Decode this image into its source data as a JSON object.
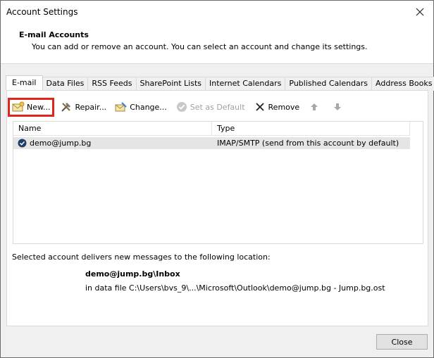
{
  "window": {
    "title": "Account Settings"
  },
  "header": {
    "title": "E-mail Accounts",
    "description": "You can add or remove an account. You can select an account and change its settings."
  },
  "tabs": [
    {
      "label": "E-mail",
      "active": true
    },
    {
      "label": "Data Files"
    },
    {
      "label": "RSS Feeds"
    },
    {
      "label": "SharePoint Lists"
    },
    {
      "label": "Internet Calendars"
    },
    {
      "label": "Published Calendars"
    },
    {
      "label": "Address Books"
    }
  ],
  "toolbar": {
    "new_label": "New...",
    "repair_label": "Repair...",
    "change_label": "Change...",
    "set_default_label": "Set as Default",
    "remove_label": "Remove"
  },
  "accounts": {
    "columns": {
      "name": "Name",
      "type": "Type"
    },
    "rows": [
      {
        "name": "demo@jump.bg",
        "type": "IMAP/SMTP (send from this account by default)"
      }
    ]
  },
  "delivery": {
    "label": "Selected account delivers new messages to the following location:",
    "folder": "demo@jump.bg\\Inbox",
    "file": "in data file C:\\Users\\bvs_9\\...\\Microsoft\\Outlook\\demo@jump.bg - Jump.bg.ost"
  },
  "footer": {
    "close_label": "Close"
  },
  "colors": {
    "highlight_border": "#e2241d",
    "selected_row": "#e5e5e5"
  }
}
